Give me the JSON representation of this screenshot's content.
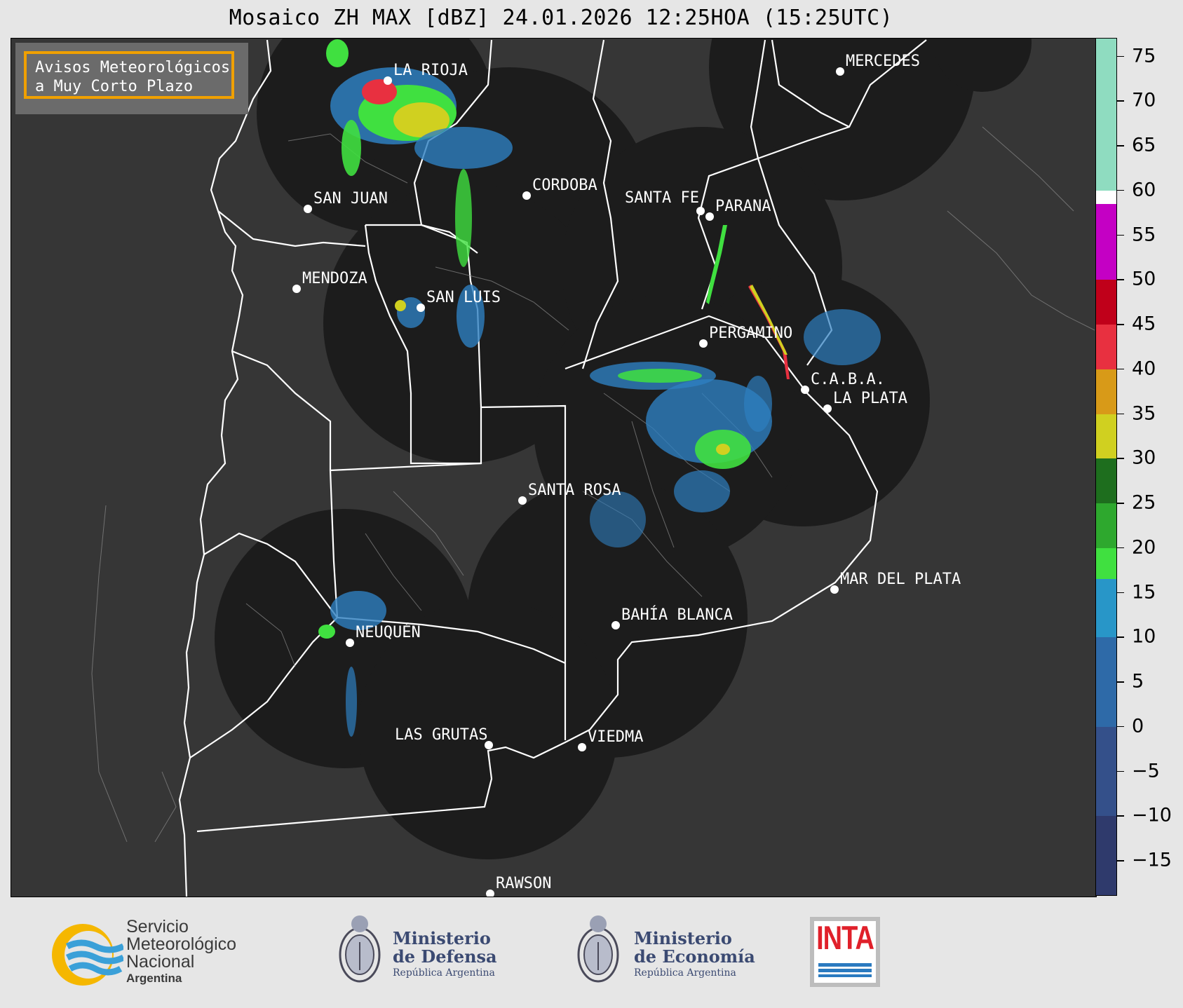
{
  "title": "Mosaico ZH MAX [dBZ] 24.01.2026 12:25HOA (15:25UTC)",
  "badge": {
    "line1": "Avisos Meteorológicos",
    "line2": "a Muy Corto Plazo",
    "border_color": "#f0a000"
  },
  "cities": [
    {
      "name": "LA RIOJA"
    },
    {
      "name": "MERCEDES"
    },
    {
      "name": "SAN JUAN"
    },
    {
      "name": "CORDOBA"
    },
    {
      "name": "SANTA FE"
    },
    {
      "name": "PARANA"
    },
    {
      "name": "MENDOZA"
    },
    {
      "name": "SAN LUIS"
    },
    {
      "name": "PERGAMINO"
    },
    {
      "name": "C.A.B.A."
    },
    {
      "name": "LA PLATA"
    },
    {
      "name": "SANTA ROSA"
    },
    {
      "name": "MAR DEL PLATA"
    },
    {
      "name": "BAHÍA BLANCA"
    },
    {
      "name": "NEUQUÉN"
    },
    {
      "name": "LAS GRUTAS"
    },
    {
      "name": "VIEDMA"
    },
    {
      "name": "RAWSON"
    }
  ],
  "colorbar": {
    "unit": "dBZ",
    "range": [
      -19,
      77
    ],
    "ticks": [
      "75",
      "70",
      "65",
      "60",
      "55",
      "50",
      "45",
      "40",
      "35",
      "30",
      "25",
      "20",
      "15",
      "10",
      "5",
      "0",
      "−5",
      "−10",
      "−15"
    ],
    "tick_values": [
      75,
      70,
      65,
      60,
      55,
      50,
      45,
      40,
      35,
      30,
      25,
      20,
      15,
      10,
      5,
      0,
      -5,
      -10,
      -15
    ],
    "bands": [
      {
        "from": 60,
        "to": 77,
        "color": "#8fdcc0"
      },
      {
        "from": 58.5,
        "to": 60,
        "color": "#ffffff"
      },
      {
        "from": 50,
        "to": 58.5,
        "color": "#c400c4"
      },
      {
        "from": 45,
        "to": 50,
        "color": "#c0001a"
      },
      {
        "from": 40,
        "to": 45,
        "color": "#e83040"
      },
      {
        "from": 35,
        "to": 40,
        "color": "#d89a18"
      },
      {
        "from": 30,
        "to": 35,
        "color": "#d0d020"
      },
      {
        "from": 25,
        "to": 30,
        "color": "#1e6e1e"
      },
      {
        "from": 20,
        "to": 25,
        "color": "#2ea82e"
      },
      {
        "from": 16.5,
        "to": 20,
        "color": "#40e040"
      },
      {
        "from": 10,
        "to": 16.5,
        "color": "#2896c8"
      },
      {
        "from": 0,
        "to": 10,
        "color": "#2e6aa8"
      },
      {
        "from": -10,
        "to": 0,
        "color": "#34508a"
      },
      {
        "from": -19,
        "to": -10,
        "color": "#2f3a6c"
      }
    ]
  },
  "logos": {
    "smn": {
      "line1": "Servicio",
      "line2": "Meteorológico",
      "line3": "Nacional",
      "line4": "Argentina"
    },
    "defensa": {
      "line1": "Ministerio",
      "line2": "de Defensa",
      "line3": "República Argentina"
    },
    "economia": {
      "line1": "Ministerio",
      "line2": "de Economía",
      "line3": "República Argentina"
    },
    "inta": {
      "text": "INTA"
    }
  },
  "colors": {
    "background": "#e6e6e6",
    "map_fill": "#363636",
    "radar_coverage": "#1c1c1c",
    "province_border": "#ffffff",
    "echo_weak": "#2e7fc0",
    "echo_moderate": "#40e040",
    "echo_strong": "#d0d020"
  }
}
